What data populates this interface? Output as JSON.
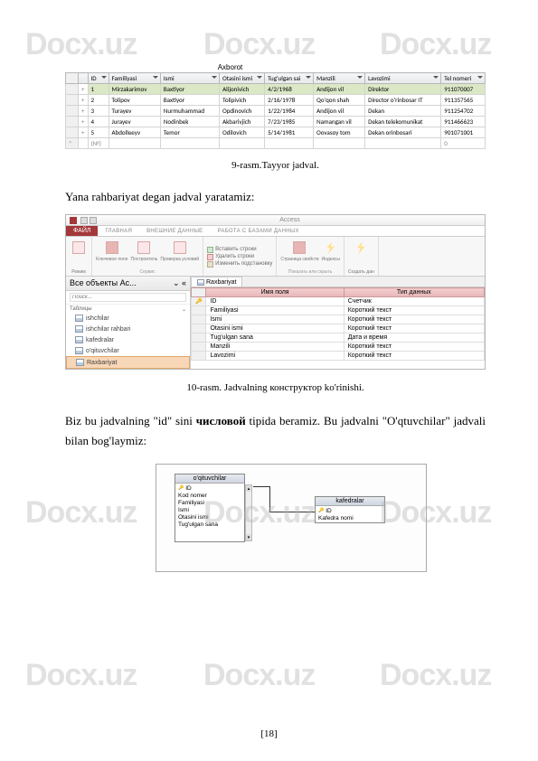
{
  "watermarks": [
    "Docx.uz"
  ],
  "table1": {
    "title": "Axborot",
    "headers": [
      "ID",
      "Familiyasi",
      "Ismi",
      "Otasini ismi",
      "Tug'ulgan sai",
      "Manzili",
      "Lavozimi",
      "Tel nomeri"
    ],
    "rows": [
      [
        "1",
        "Mirzakarimov",
        "Baxtiyor",
        "Alijonivich",
        "4/2/1968",
        "Andijon vil",
        "Direktor",
        "911070007"
      ],
      [
        "2",
        "Tolipov",
        "Baxtiyor",
        "Tolipivich",
        "2/16/1978",
        "Qo'qon shah",
        "Director o'rinbosar IT",
        "911357565"
      ],
      [
        "3",
        "Turayev",
        "Nurmuhammad",
        "Opdinovich",
        "1/22/1984",
        "Andijon vil",
        "Dekan",
        "911254702"
      ],
      [
        "4",
        "Jurayev",
        "Nodinbek",
        "Akbarivjich",
        "7/23/1985",
        "Namangan vil",
        "Dekan telekomunikat",
        "911466623"
      ],
      [
        "5",
        "Abdolleeyv",
        "Temor",
        "Odilovich",
        "5/14/1981",
        "Oovasoy tom",
        "Dekan orinbosari",
        "901071001"
      ],
      [
        "(№)",
        "",
        "",
        "",
        "",
        "",
        "",
        "0"
      ]
    ]
  },
  "caption9": "9-rasm.Tayyor jadval.",
  "para1": "Yana rahbariyat degan jadval yaratamiz:",
  "access": {
    "app_title": "Access",
    "file_tab": "ФАЙЛ",
    "tabs": [
      "ГЛАВНАЯ",
      "ВНЕШНИЕ ДАННЫЕ",
      "РАБОТА С БАЗАМИ ДАННЫХ"
    ],
    "ribbon": {
      "group1": {
        "btn1": "Режим",
        "btn2": "Ключевое\nполе",
        "btn3": "Построитель",
        "btn4": "Проверка\nусловий",
        "name": "Сервис"
      },
      "group2": {
        "item1": "Вставить строки",
        "item2": "Удалить строки",
        "item3": "Изменить подстановку"
      },
      "group3": {
        "btn1": "Страница\nсвойств",
        "btn2": "Индексы",
        "name": "Показать или скрыть"
      },
      "group4": {
        "btn1": "Создать\nдан"
      }
    },
    "nav": {
      "header": "Все объекты Ac...",
      "search_placeholder": "Поиск...",
      "group": "Таблицы",
      "items": [
        "ishchilar",
        "ishchilar rahbari",
        "kafedralar",
        "o'qituvchilar",
        "Raxbariyat"
      ]
    },
    "doc_tab": "Raxbariyat",
    "design": {
      "col1": "Имя поля",
      "col2": "Тип данных",
      "fields": [
        {
          "name": "ID",
          "type": "Счетчик",
          "pk": true
        },
        {
          "name": "Familiyasi",
          "type": "Короткий текст"
        },
        {
          "name": "Ismi",
          "type": "Короткий текст"
        },
        {
          "name": "Otasini ismi",
          "type": "Короткий текст"
        },
        {
          "name": "Tug'ulgan sana",
          "type": "Дата и время"
        },
        {
          "name": "Manzili",
          "type": "Короткий текст"
        },
        {
          "name": "Lavozimi",
          "type": "Короткий текст"
        }
      ]
    }
  },
  "caption10": "10-rasm. Jadvalning конструктор ko'rinishi.",
  "para2_parts": {
    "a": "Biz bu jadvalning \"id\" sini ",
    "b": "числовой",
    "c": " tipida beramiz. Bu jadvalni \"O'qtuvchilar\" jadvali bilan bog'laymiz:"
  },
  "rel": {
    "t1": {
      "title": "o'qituvchilar",
      "fields": [
        "ID",
        "Kod nomer",
        "Familiyasi",
        "Ismi",
        "Otasini ismi",
        "Tug'ulgan sana"
      ]
    },
    "t2": {
      "title": "kafedralar",
      "fields": [
        "ID",
        "Kafedra nomi"
      ]
    }
  },
  "page_number": "[18]"
}
